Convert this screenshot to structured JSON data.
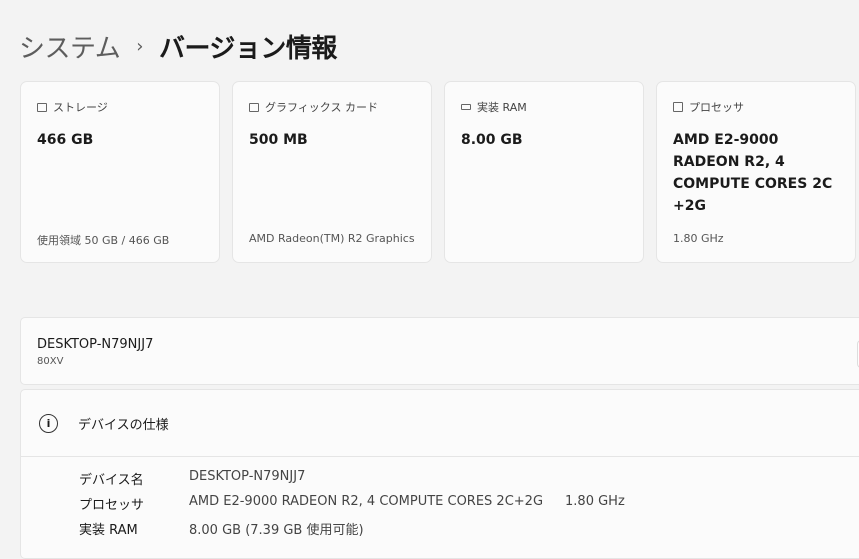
{
  "breadcrumb": {
    "parent": "システム",
    "separator": "›",
    "current": "バージョン情報"
  },
  "cards": [
    {
      "label": "ストレージ",
      "icon": "storage-icon",
      "value": "466 GB",
      "sub": "使用領域 50 GB / 466 GB"
    },
    {
      "label": "グラフィックス カード",
      "icon": "display-icon",
      "value": "500 MB",
      "sub": "AMD Radeon(TM) R2 Graphics"
    },
    {
      "label": "実装 RAM",
      "icon": "memory-icon",
      "value": "8.00 GB",
      "sub": ""
    },
    {
      "label": "プロセッサ",
      "icon": "cpu-icon",
      "value": "AMD E2-9000 RADEON R2, 4 COMPUTE CORES 2C +2G",
      "sub": "1.80 GHz"
    }
  ],
  "device": {
    "name": "DESKTOP-N79NJJ7",
    "model": "80XV"
  },
  "spec": {
    "title": "デバイスの仕様",
    "info_glyph": "i",
    "rows": [
      {
        "key": "デバイス名",
        "value": "DESKTOP-N79NJJ7",
        "extra": ""
      },
      {
        "key": "プロセッサ",
        "value": "AMD E2-9000 RADEON R2, 4 COMPUTE CORES 2C+2G",
        "extra": "1.80 GHz"
      },
      {
        "key": "実装 RAM",
        "value": "8.00 GB (7.39 GB 使用可能)",
        "extra": ""
      }
    ]
  }
}
